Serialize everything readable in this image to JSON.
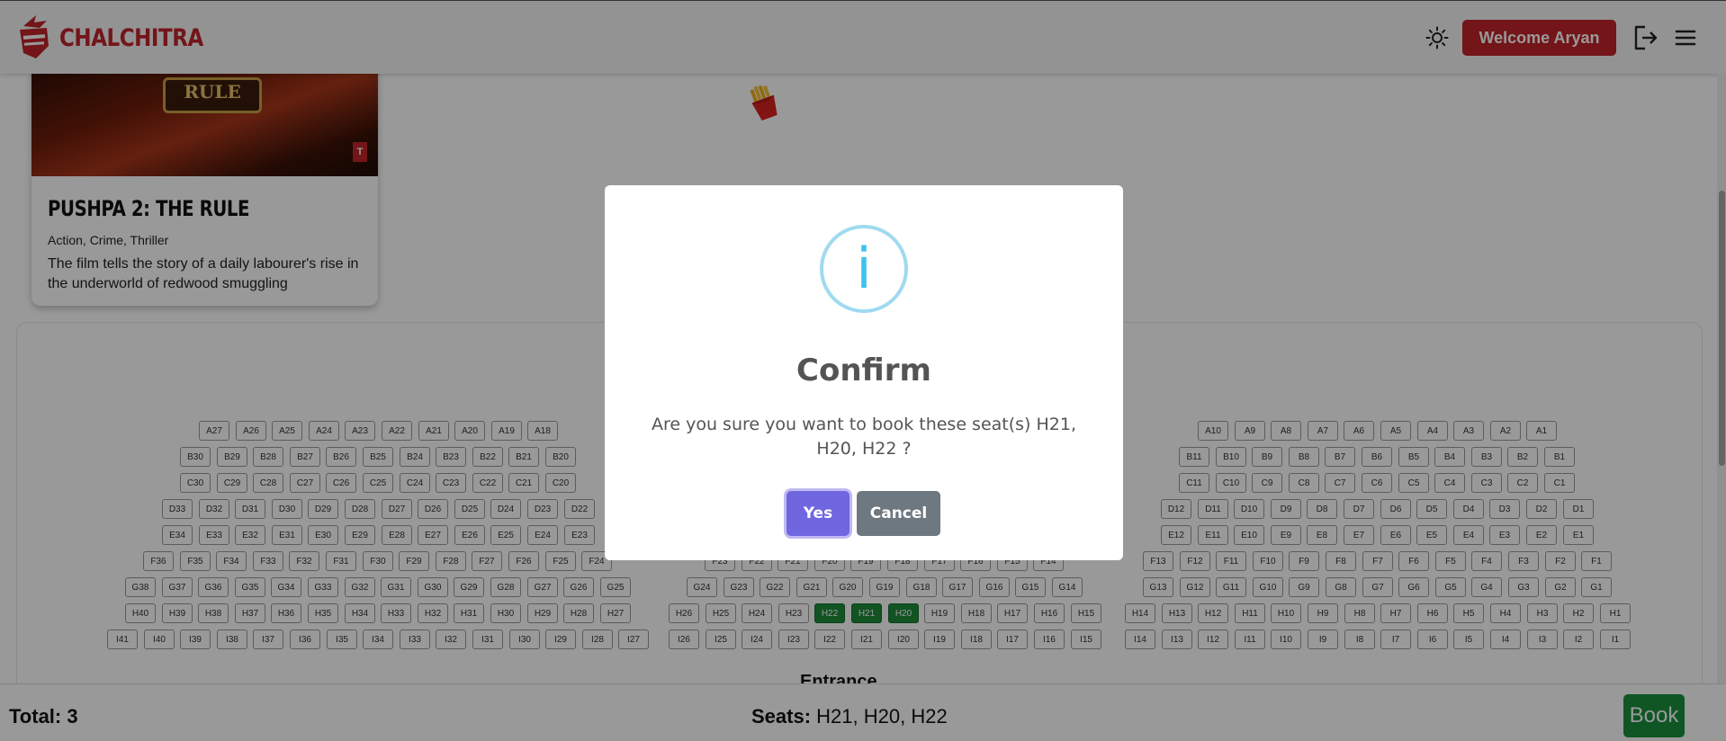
{
  "header": {
    "brand": "CHALCHITRA",
    "welcome_label": "Welcome Aryan",
    "icons": {
      "theme": "sun-icon",
      "logout": "logout-icon",
      "menu": "hamburger-menu-icon"
    },
    "brand_color": "#c0242b"
  },
  "movie": {
    "title": "PUSHPA 2: THE RULE",
    "genres": "Action, Crime, Thriller",
    "description": "The film tells the story of a daily labourer's rise in the underworld of redwood smuggling",
    "poster_text": "RULE"
  },
  "decor": {
    "snack_icon": "french-fries-icon"
  },
  "seat_map": {
    "entrance_label": "Entrance",
    "selected": [
      "H21",
      "H20",
      "H22"
    ],
    "selected_color": "#1e8a3a"
  },
  "footer": {
    "total_label": "Total:",
    "total_value": "3",
    "seats_label": "Seats:",
    "seats_value": "H21, H20, H22",
    "book_label": "Book",
    "book_color": "#198f3c"
  },
  "dialog": {
    "icon": "info-icon",
    "icon_glyph": "i",
    "title": "Confirm",
    "message": "Are you sure you want to book these seat(s) H21, H20, H22 ?",
    "yes_label": "Yes",
    "cancel_label": "Cancel",
    "yes_color": "#7066e0",
    "cancel_color": "#6e7881"
  }
}
